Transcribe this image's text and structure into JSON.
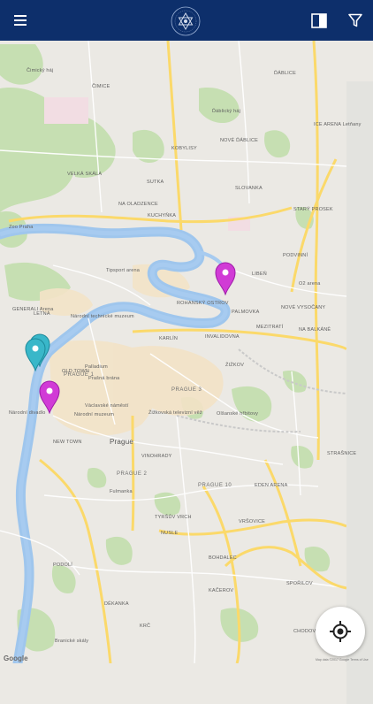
{
  "header": {
    "menu_icon": "hamburger-menu-icon",
    "logo_icon": "star-of-david-seal-icon",
    "book_icon": "open-book-icon",
    "filter_icon": "funnel-filter-icon",
    "background_color": "#0d2f6b"
  },
  "map": {
    "labels": [
      {
        "id": "cimice",
        "text": "ČIMICE"
      },
      {
        "id": "dablice",
        "text": "ĎÁBLICE"
      },
      {
        "id": "novezablice",
        "text": "NOVÉ ĎÁBLICE"
      },
      {
        "id": "kobylisy",
        "text": "KOBYLISY"
      },
      {
        "id": "velkaskala",
        "text": "VELKÁ SKÁLA"
      },
      {
        "id": "sutka",
        "text": "SUTKA"
      },
      {
        "id": "slovanka",
        "text": "SLOVANKA"
      },
      {
        "id": "naoladzenec",
        "text": "NA OLADZENCE"
      },
      {
        "id": "kuchynka",
        "text": "KUCHYŇKA"
      },
      {
        "id": "staryprosek",
        "text": "STARÝ PROSEK"
      },
      {
        "id": "icearena",
        "text": "ICE ARENA Letňany"
      },
      {
        "id": "zoopraha",
        "text": "Zoo Praha"
      },
      {
        "id": "letna",
        "text": "LETNÁ"
      },
      {
        "id": "generali",
        "text": "GENERALI Arena"
      },
      {
        "id": "tipsport",
        "text": "Tipsport arena"
      },
      {
        "id": "narodnitech",
        "text": "Národní technické muzeum"
      },
      {
        "id": "rohansky",
        "text": "ROHANSKÝ OSTROV"
      },
      {
        "id": "lieben",
        "text": "LIBEŇ"
      },
      {
        "id": "o2arena",
        "text": "O2 arena"
      },
      {
        "id": "vysocany",
        "text": "NOVÉ VYSOČANY"
      },
      {
        "id": "podvinni",
        "text": "PODVINNÍ"
      },
      {
        "id": "zizkov",
        "text": "ŽIŽKOV"
      },
      {
        "id": "karlin",
        "text": "KARLÍN"
      },
      {
        "id": "invalidovna",
        "text": "INVALIDOVNA"
      },
      {
        "id": "palmovka",
        "text": "PALMOVKA"
      },
      {
        "id": "mezitrati",
        "text": "MEZITRATÍ"
      },
      {
        "id": "nabalkane",
        "text": "NA BALKÁNĚ"
      },
      {
        "id": "prague1",
        "text": "PRAGUE 1"
      },
      {
        "id": "prague3",
        "text": "PRAGUE 3"
      },
      {
        "id": "prague",
        "text": "Prague"
      },
      {
        "id": "newtown",
        "text": "NEW TOWN"
      },
      {
        "id": "oldtown",
        "text": "OLD TOWN"
      },
      {
        "id": "zizkovtv",
        "text": "Žižkovská televizní věž"
      },
      {
        "id": "olsany",
        "text": "Olšanské hřbitovy"
      },
      {
        "id": "vinohrady",
        "text": "VINOHRADY"
      },
      {
        "id": "prague2",
        "text": "PRAGUE 2"
      },
      {
        "id": "prague10",
        "text": "PRAGUE 10"
      },
      {
        "id": "edenarena",
        "text": "EDEN ARENA"
      },
      {
        "id": "strasnice",
        "text": "STRAŠNICE"
      },
      {
        "id": "vrsovice",
        "text": "VRŠOVICE"
      },
      {
        "id": "nusle",
        "text": "NUSLE"
      },
      {
        "id": "bohdalec",
        "text": "BOHDALEC"
      },
      {
        "id": "tyrsuvvrch",
        "text": "TYRŠŮV VRCH"
      },
      {
        "id": "podoli",
        "text": "PODOLÍ"
      },
      {
        "id": "dekanka",
        "text": "DĚKANKA"
      },
      {
        "id": "krc",
        "text": "KRČ"
      },
      {
        "id": "kacerov",
        "text": "KAČEROV"
      },
      {
        "id": "sporilov",
        "text": "SPOŘILOV"
      },
      {
        "id": "chodovec",
        "text": "CHODOVEC"
      },
      {
        "id": "branickeskaly",
        "text": "Branické skály"
      },
      {
        "id": "fulmanka",
        "text": "Fulmanka"
      },
      {
        "id": "narodnimuzeum",
        "text": "Národní muzeum"
      },
      {
        "id": "vaclavske",
        "text": "Václavské náměstí"
      },
      {
        "id": "narodnidivadlo",
        "text": "Národní divadlo"
      },
      {
        "id": "prasnabrana",
        "text": "Prašná brána"
      },
      {
        "id": "palladium",
        "text": "Palladium"
      },
      {
        "id": "zelenyhaj",
        "text": "Čimický háj"
      },
      {
        "id": "zdanskyhaj",
        "text": "Ďáblický háj"
      }
    ],
    "google_mark": "Google",
    "attribution": "Map data ©2017 Google   Terms of Use"
  },
  "markers": [
    {
      "id": "marker-libeň",
      "color": "#d13bd6",
      "label": "magenta-marker"
    },
    {
      "id": "marker-oldtown",
      "color": "#d13bd6",
      "label": "magenta-marker"
    },
    {
      "id": "marker-cluster-1",
      "color": "#39b7c9",
      "label": "cyan-marker"
    },
    {
      "id": "marker-cluster-2",
      "color": "#39b7c9",
      "label": "cyan-marker"
    }
  ],
  "controls": {
    "locate_icon": "crosshair-locate-icon"
  }
}
